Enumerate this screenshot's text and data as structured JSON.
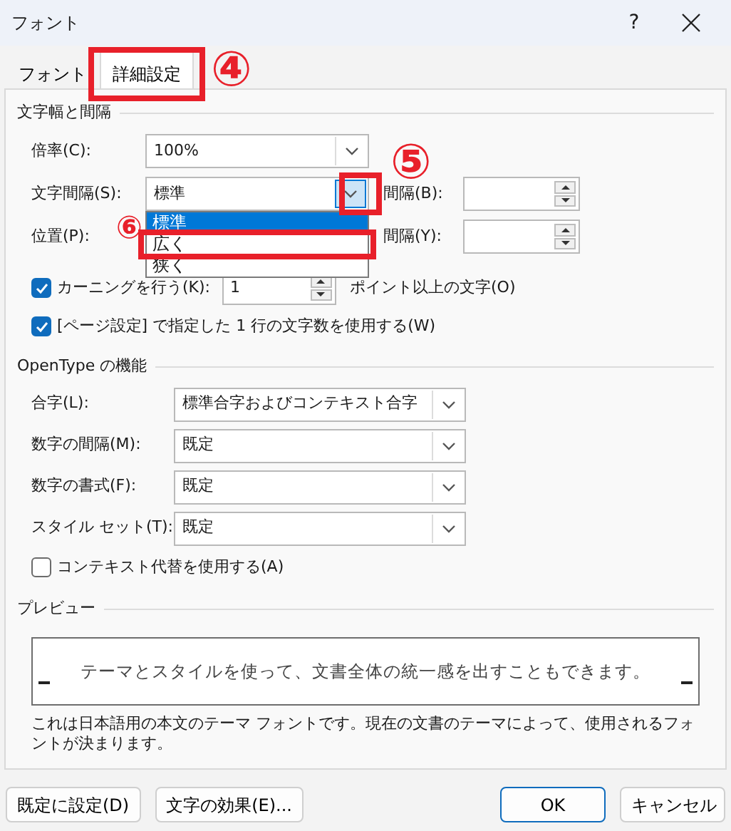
{
  "window": {
    "title": "フォント",
    "help": "?"
  },
  "tabs": [
    {
      "label": "フォント",
      "selected": false
    },
    {
      "label": "詳細設定",
      "selected": true,
      "annotation": "④"
    }
  ],
  "spacing_section": {
    "heading": "文字幅と間隔",
    "scale": {
      "label": "倍率(C):",
      "value": "100%"
    },
    "spacing": {
      "label": "文字間隔(S):",
      "value": "標準",
      "open": true,
      "annotation": "⑤",
      "side_label": "間隔(B):",
      "options": [
        {
          "label": "標準",
          "selected": true
        },
        {
          "label": "広く",
          "selected": false,
          "annotation": "⑥"
        },
        {
          "label": "狭く",
          "selected": false
        }
      ]
    },
    "position": {
      "label": "位置(P):",
      "side_label": "間隔(Y):"
    },
    "kerning": {
      "checked": true,
      "label": "カーニングを行う(K):",
      "value": "1",
      "suffix": "ポイント以上の文字(O)"
    },
    "grid": {
      "checked": true,
      "label": "[ページ設定] で指定した 1 行の文字数を使用する(W)"
    }
  },
  "opentype": {
    "heading": "OpenType の機能",
    "rows": [
      {
        "label": "合字(L):",
        "value": "標準合字およびコンテキスト合字"
      },
      {
        "label": "数字の間隔(M):",
        "value": "既定"
      },
      {
        "label": "数字の書式(F):",
        "value": "既定"
      },
      {
        "label": "スタイル セット(T):",
        "value": "既定"
      }
    ],
    "contextual": {
      "checked": false,
      "label": "コンテキスト代替を使用する(A)"
    }
  },
  "preview": {
    "heading": "プレビュー",
    "sample": "テーマとスタイルを使って、文書全体の統一感を出すこともできます。",
    "note": "これは日本語用の本文のテーマ フォントです。現在の文書のテーマによって、使用されるフォントが決まります。"
  },
  "buttons": [
    {
      "label": "既定に設定(D)",
      "kind": "secondary"
    },
    {
      "label": "文字の効果(E)...",
      "kind": "secondary"
    },
    {
      "label": "OK",
      "kind": "default"
    },
    {
      "label": "キャンセル",
      "kind": "secondary"
    }
  ]
}
